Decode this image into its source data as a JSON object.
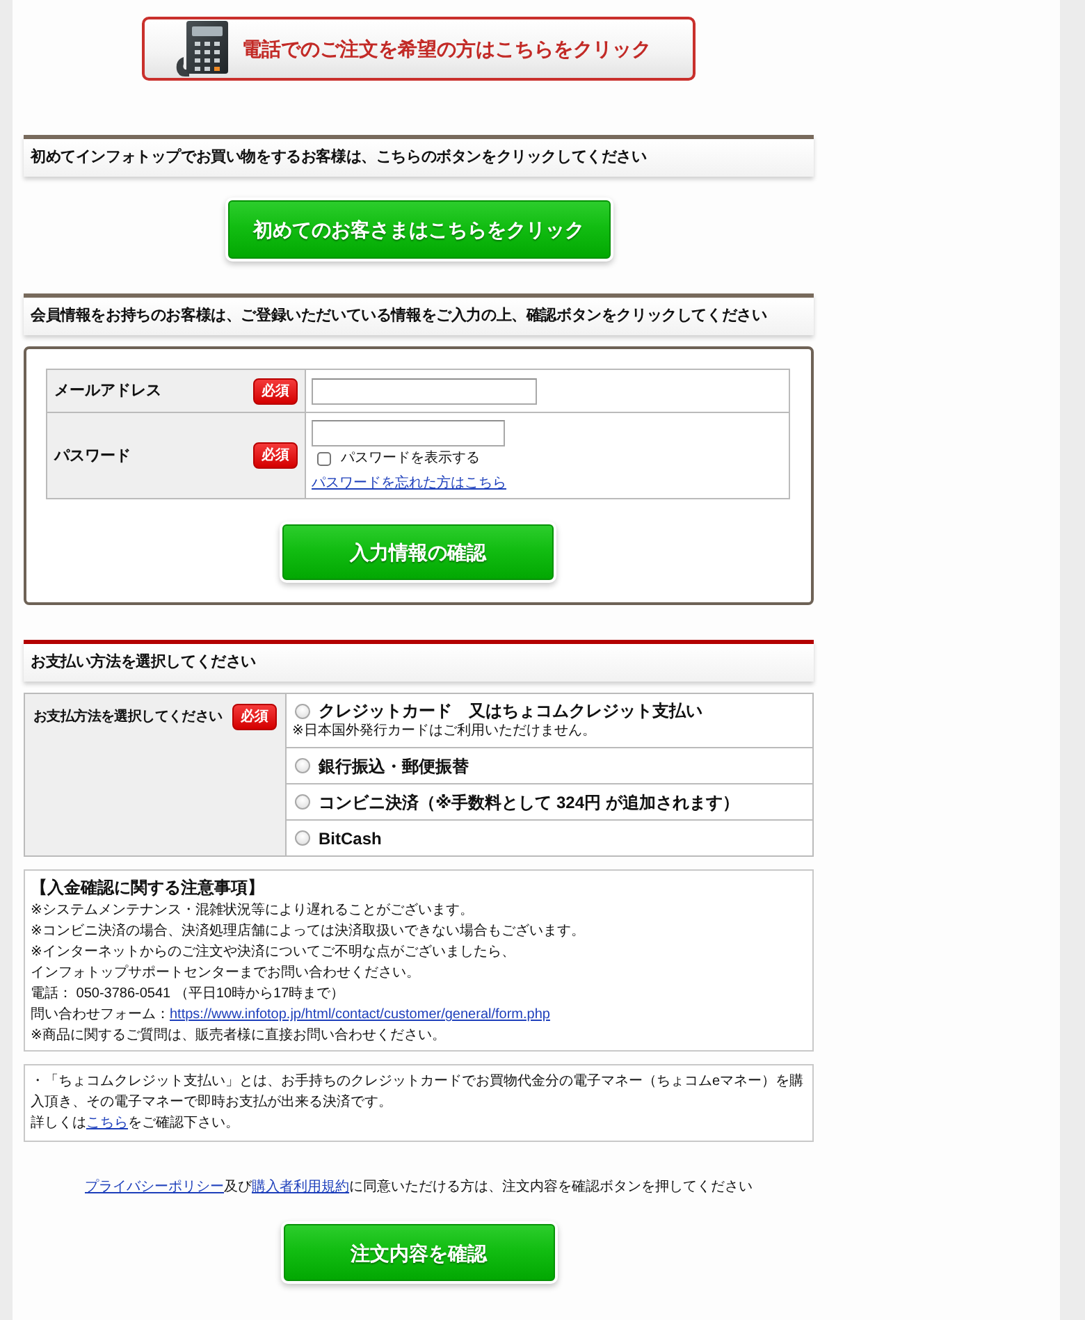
{
  "phone_order_banner": {
    "label": "電話でのご注文を希望の方はこちらをクリック"
  },
  "new_customer": {
    "heading": "初めてインフォトップでお買い物をするお客様は、こちらのボタンをクリックしてください",
    "button": "初めてのお客さまはこちらをクリック"
  },
  "member_login": {
    "heading": "会員情報をお持ちのお客様は、ご登録いただいている情報をご入力の上、確認ボタンをクリックしてください",
    "fields": [
      {
        "kind": "email",
        "label": "メールアドレス",
        "badge": "必須"
      },
      {
        "kind": "password",
        "label": "パスワード",
        "badge": "必須",
        "show_password": {
          "label": "パスワードを表示する",
          "checked": false
        },
        "forgot_link": "パスワードを忘れた方はこちら"
      }
    ],
    "button": "入力情報の確認"
  },
  "payment": {
    "heading": "お支払い方法を選択してください",
    "label": "お支払方法を選択してください",
    "badge": "必須",
    "options": [
      {
        "label": "クレジットカード　又はちょコムクレジット支払い",
        "note": "※日本国外発行カードはご利用いただけません。",
        "selected": false
      },
      {
        "label": "銀行振込・郵便振替",
        "selected": false
      },
      {
        "label": "コンビニ決済（※手数料として 324円 が追加されます）",
        "selected": false
      },
      {
        "label": "BitCash",
        "selected": false
      }
    ]
  },
  "payment_notice": {
    "title": "【入金確認に関する注意事項】",
    "lines": [
      {
        "parts": [
          {
            "kind": "text",
            "text": "※システムメンテナンス・混雑状況等により遅れることがございます。"
          }
        ]
      },
      {
        "parts": [
          {
            "kind": "text",
            "text": "※コンビニ決済の場合、決済処理店舗によっては決済取扱いできない場合もございます。"
          }
        ]
      },
      {
        "parts": [
          {
            "kind": "text",
            "text": "※インターネットからのご注文や決済についてご不明な点がございましたら、"
          }
        ]
      },
      {
        "parts": [
          {
            "kind": "text",
            "text": "インフォトップサポートセンターまでお問い合わせください。"
          }
        ]
      },
      {
        "parts": [
          {
            "kind": "text",
            "text": "電話： 050-3786-0541 （平日10時から17時まで）"
          }
        ]
      },
      {
        "parts": [
          {
            "kind": "text",
            "text": "問い合わせフォーム："
          },
          {
            "kind": "link",
            "text": "https://www.infotop.jp/html/contact/customer/general/form.php"
          }
        ]
      },
      {
        "parts": [
          {
            "kind": "text",
            "text": "※商品に関するご質問は、販売者様に直接お問い合わせください。"
          }
        ]
      }
    ]
  },
  "chocom_info": {
    "description": "・「ちょコムクレジット支払い」とは、お手持ちのクレジットカードでお買物代金分の電子マネー（ちょコムeマネー）を購入頂き、その電子マネーで即時お支払が出来る決済です。",
    "details": [
      {
        "kind": "text",
        "text": "詳しくは"
      },
      {
        "kind": "link",
        "text": "こちら"
      },
      {
        "kind": "text",
        "text": "をご確認下さい。"
      }
    ]
  },
  "agreement": {
    "parts": [
      {
        "kind": "link",
        "text": "プライバシーポリシー"
      },
      {
        "kind": "text",
        "text": "及び"
      },
      {
        "kind": "link",
        "text": "購入者利用規約"
      },
      {
        "kind": "text",
        "text": "に同意いただける方は、注文内容を確認ボタンを押してください"
      }
    ]
  },
  "submit_button": "注文内容を確認"
}
